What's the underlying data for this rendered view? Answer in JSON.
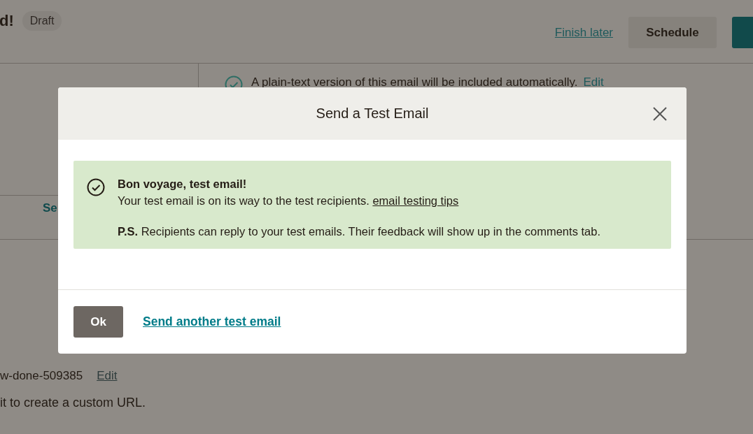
{
  "header": {
    "title": "d!",
    "badge": "Draft",
    "finish_later": "Finish later",
    "schedule": "Schedule"
  },
  "checklist": {
    "text": "A plain-text version of this email will be included automatically.",
    "edit": "Edit"
  },
  "left_link": "Se",
  "url": {
    "slug": "w-done-509385",
    "edit": "Edit",
    "hint": "it to create a custom URL."
  },
  "modal": {
    "title": "Send a Test Email",
    "alert": {
      "heading": "Bon voyage, test email!",
      "message": "Your test email is on its way to the test recipients.",
      "link": "email testing tips",
      "note": "**P.S.** Recipients can reply to your test emails. Their feedback will show up in the comments tab."
    },
    "ok": "Ok",
    "send_another": "Send another test email"
  }
}
